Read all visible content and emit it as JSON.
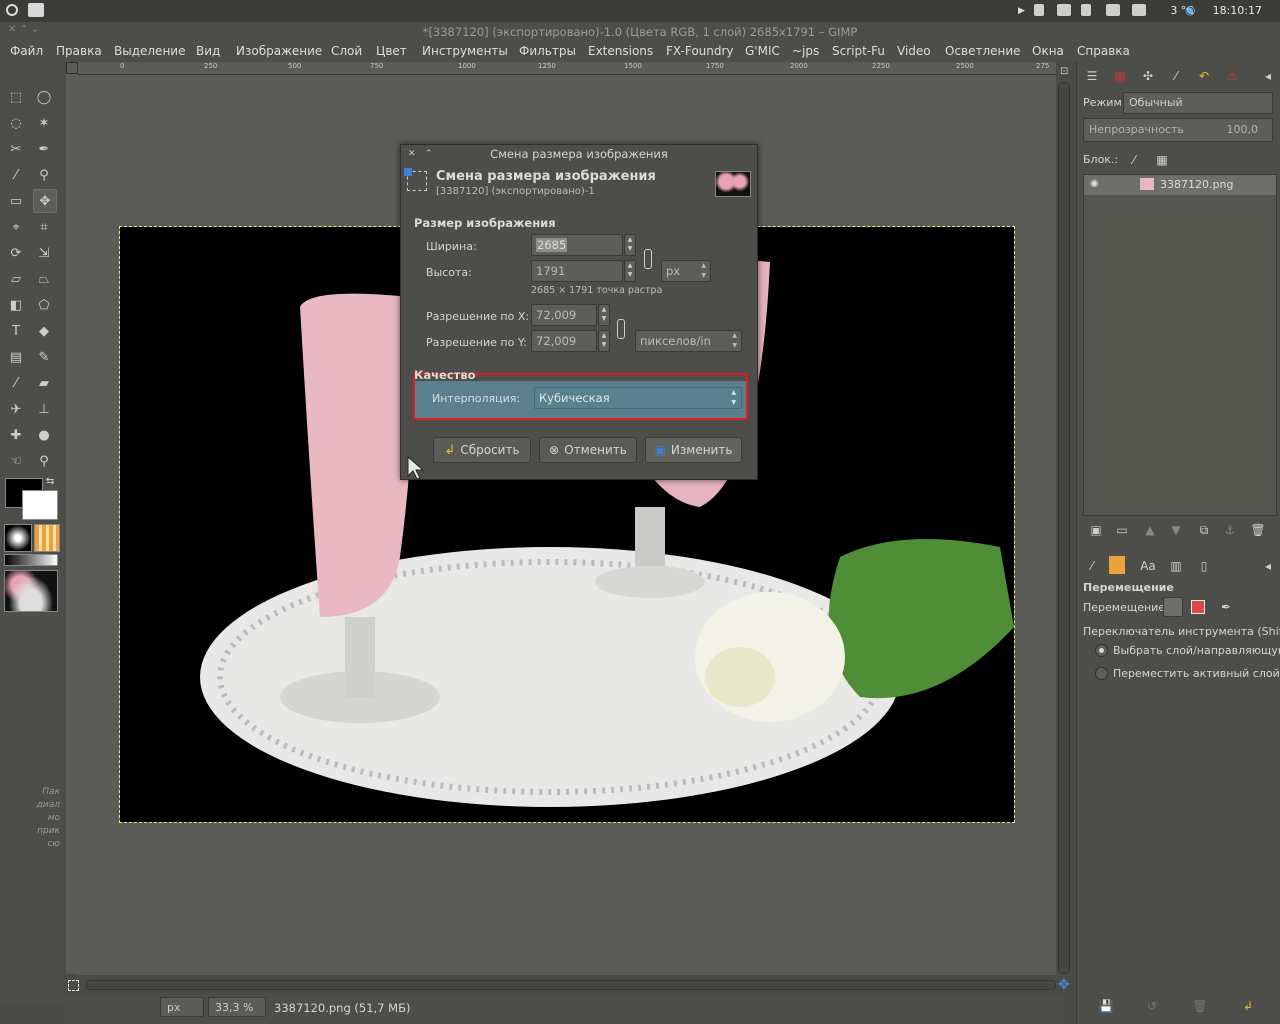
{
  "system": {
    "temperature": "3 °C",
    "clock": "18:10:17"
  },
  "window": {
    "title": "*[3387120] (экспортировано)-1.0 (Цвета RGB, 1 слой) 2685x1791 – GIMP"
  },
  "menu": [
    "Файл",
    "Правка",
    "Выделение",
    "Вид",
    "Изображение",
    "Слой",
    "Цвет",
    "Инструменты",
    "Фильтры",
    "Extensions",
    "FX-Foundry",
    "G'MIC",
    "~jps",
    "Script-Fu",
    "Video",
    "Осветление",
    "Окна",
    "Справка"
  ],
  "ruler": {
    "top": [
      "0",
      "250",
      "500",
      "750",
      "1000",
      "1250",
      "1500",
      "1750",
      "2000",
      "2250",
      "2500",
      "275"
    ]
  },
  "toolbox_hint": [
    "Пак",
    "диал",
    "мо",
    "прик",
    "сю"
  ],
  "dialog": {
    "window_title": "Смена размера изображения",
    "heading": "Смена размера изображения",
    "subheading": "[3387120] (экспортировано)-1",
    "size_section": "Размер изображения",
    "width_label": "Ширина:",
    "width_value": "2685",
    "height_label": "Высота:",
    "height_value": "1791",
    "size_unit": "px",
    "size_info": "2685 × 1791 точка растра",
    "xres_label": "Разрешение по X:",
    "xres_value": "72,009",
    "yres_label": "Разрешение по Y:",
    "yres_value": "72,009",
    "res_unit": "пикселов/in",
    "quality_section": "Качество",
    "interp_label": "Интерполяция:",
    "interp_value": "Кубическая",
    "reset_button": "Сбросить",
    "cancel_button": "Отменить",
    "scale_button": "Изменить"
  },
  "layers": {
    "mode_label": "Режим:",
    "mode_value": "Обычный",
    "opacity_label": "Непрозрачность",
    "opacity_value": "100,0",
    "lock_label": "Блок.:",
    "layer_name": "3387120.png"
  },
  "tool_options": {
    "title": "Перемещение",
    "move_label": "Перемещение:",
    "switch_label": "Переключатель инструмента  (Shift)",
    "option1": "Выбрать слой/направляющую",
    "option2": "Переместить активный слой"
  },
  "status": {
    "unit": "px",
    "zoom": "33,3 %",
    "file_info": "3387120.png (51,7 МБ)"
  },
  "colors": {
    "highlight": "#e01b24",
    "selection_field": "#5b7f8c",
    "background": "#4a4b46"
  }
}
